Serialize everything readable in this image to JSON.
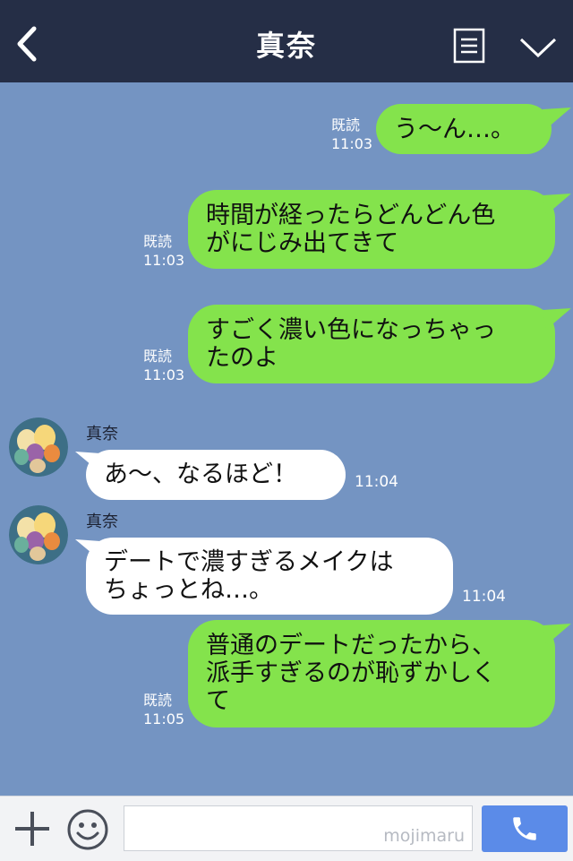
{
  "header": {
    "title": "真奈",
    "back_icon": "chevron-left-icon",
    "menu_icon": "memo-icon",
    "expand_icon": "chevron-down-icon"
  },
  "colors": {
    "header_bg": "#252e46",
    "chat_bg": "#7494c2",
    "sent_bubble": "#84e34c",
    "received_bubble": "#ffffff",
    "call_button": "#5b8be8"
  },
  "messages": [
    {
      "direction": "sent",
      "lines": [
        "う〜ん…。"
      ],
      "read": "既読",
      "time": "11:03"
    },
    {
      "direction": "sent",
      "lines": [
        "時間が経ったらどんどん色",
        "がにじみ出てきて"
      ],
      "read": "既読",
      "time": "11:03"
    },
    {
      "direction": "sent",
      "lines": [
        "すごく濃い色になっちゃっ",
        "たのよ"
      ],
      "read": "既読",
      "time": "11:03"
    },
    {
      "direction": "received",
      "sender": "真奈",
      "lines": [
        "あ〜、なるほど！"
      ],
      "time": "11:04"
    },
    {
      "direction": "received",
      "sender": "真奈",
      "lines": [
        "デートで濃すぎるメイクは",
        "ちょっとね…。"
      ],
      "time": "11:04"
    },
    {
      "direction": "sent",
      "lines": [
        "普通のデートだったから、",
        "派手すぎるのが恥ずかしく",
        "て"
      ],
      "read": "既読",
      "time": "11:05"
    }
  ],
  "input": {
    "value": "",
    "watermark": "mojimaru"
  },
  "toolbar": {
    "plus_icon": "plus-icon",
    "emoji_icon": "smiley-icon",
    "call_icon": "phone-icon"
  }
}
